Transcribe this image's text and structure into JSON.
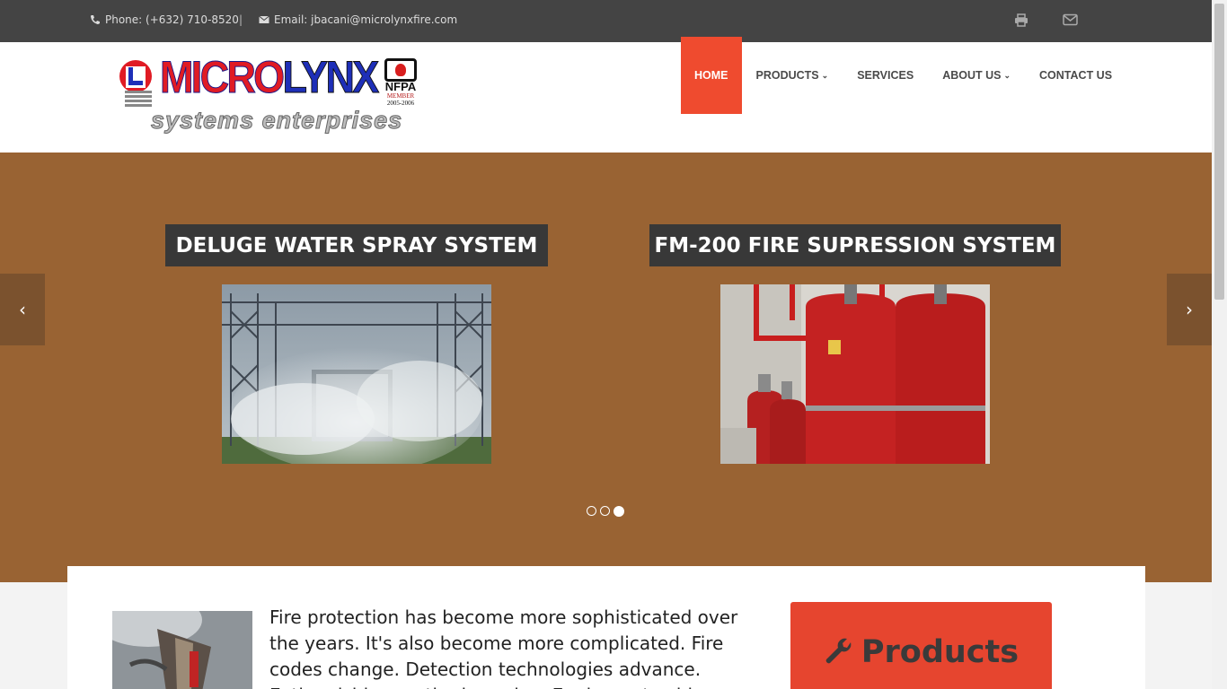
{
  "topbar": {
    "phone": "Phone: (+632) 710-8520",
    "separator": "|",
    "email": "Email: jbacani@microlynxfire.com",
    "icons": [
      "phone-icon",
      "envelope-icon",
      "print-icon",
      "mail-icon"
    ]
  },
  "logo": {
    "word_red": "MICRO",
    "word_blue": "LYNX",
    "tagline": "systems enterprises",
    "nfpa": "NFPA",
    "nfpa_member": "MEMBER",
    "nfpa_years": "2005-2006"
  },
  "nav": {
    "items": [
      {
        "label": "HOME",
        "active": true
      },
      {
        "label": "PRODUCTS",
        "dropdown": true
      },
      {
        "label": "SERVICES"
      },
      {
        "label": "ABOUT US",
        "dropdown": true
      },
      {
        "label": "CONTACT US"
      }
    ]
  },
  "slider": {
    "slides": [
      {
        "title": "DELUGE WATER SPRAY SYSTEM"
      },
      {
        "title": "FM-200 FIRE SUPRESSION SYSTEM"
      }
    ],
    "dots": 3,
    "active_dot": 3
  },
  "content": {
    "paragraph": "Fire protection has become more sophisticated over the years. It's also become more complicated. Fire codes change. Detection technologies advance. Extinguishing methods evolve. Equipment achieves",
    "products_label": "Products"
  },
  "colors": {
    "accent": "#ef4b2f",
    "slider_bg": "#996333",
    "topbar_bg": "#444444",
    "title_bg": "#383838"
  }
}
